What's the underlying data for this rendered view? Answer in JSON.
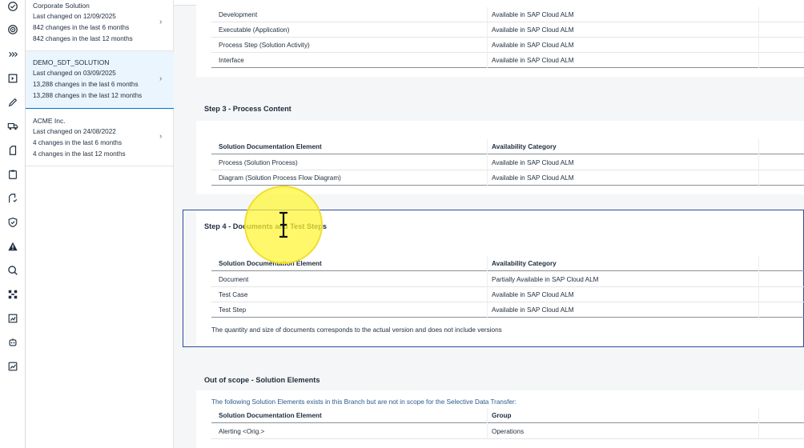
{
  "rail": {
    "icons": [
      "check-circle-icon",
      "target-icon",
      "expand-right-icon",
      "document-play-icon",
      "edit-icon",
      "truck-icon",
      "document-icon",
      "clipboard-icon",
      "checklist-icon",
      "shield-check-icon",
      "warning-icon",
      "search-icon",
      "network-icon",
      "report-icon",
      "robot-icon",
      "analytics-icon"
    ]
  },
  "solutions": [
    {
      "name": "Corporate Solution",
      "last_changed": "Last changed on 12/09/2025",
      "six_months": "842 changes in the last 6 months",
      "twelve_months": "842 changes in the last 12 months"
    },
    {
      "name": "DEMO_SDT_SOLUTION",
      "last_changed": "Last changed on 03/09/2025",
      "six_months": "13,288 changes in the last 6 months",
      "twelve_months": "13,288 changes in the last 12 months"
    },
    {
      "name": "ACME Inc.",
      "last_changed": "Last changed on 24/08/2022",
      "six_months": "4 changes in the last 6 months",
      "twelve_months": "4 changes in the last 12 months"
    }
  ],
  "step2": {
    "rows": [
      {
        "element": "Development",
        "availability": "Available in SAP Cloud ALM"
      },
      {
        "element": "Executable (Application)",
        "availability": "Available in SAP Cloud ALM"
      },
      {
        "element": "Process Step (Solution Activity)",
        "availability": "Available in SAP Cloud ALM"
      },
      {
        "element": "Interface",
        "availability": "Available in SAP Cloud ALM"
      }
    ]
  },
  "step3": {
    "title": "Step 3 - Process Content",
    "col1": "Solution Documentation Element",
    "col2": "Availability Category",
    "rows": [
      {
        "element": "Process (Solution Process)",
        "availability": "Available in SAP Cloud ALM"
      },
      {
        "element": "Diagram (Solution Process Flow Diagram)",
        "availability": "Available in SAP Cloud ALM"
      }
    ]
  },
  "step4": {
    "title": "Step 4 - Documents and Test Steps",
    "col1": "Solution Documentation Element",
    "col2": "Availability Category",
    "rows": [
      {
        "element": "Document",
        "availability": "Partially Available in SAP Cloud ALM"
      },
      {
        "element": "Test Case",
        "availability": "Available in SAP Cloud ALM"
      },
      {
        "element": "Test Step",
        "availability": "Available in SAP Cloud ALM"
      }
    ],
    "note": "The quantity and size of documents corresponds to the actual version and does not include versions"
  },
  "out_of_scope": {
    "title": "Out of scope - Solution Elements",
    "note": "The following Solution Elements exists in this Branch but are not in scope for the Selective Data Transfer:",
    "col1": "Solution Documentation Element",
    "col2": "Group",
    "rows": [
      {
        "element": "Alerting <Orig.>",
        "group": "Operations"
      }
    ]
  },
  "colors": {
    "accent": "#0a6ed1",
    "focus": "#2a4c9f",
    "selected": "#ebf5fe",
    "cursor": "#fff532"
  }
}
